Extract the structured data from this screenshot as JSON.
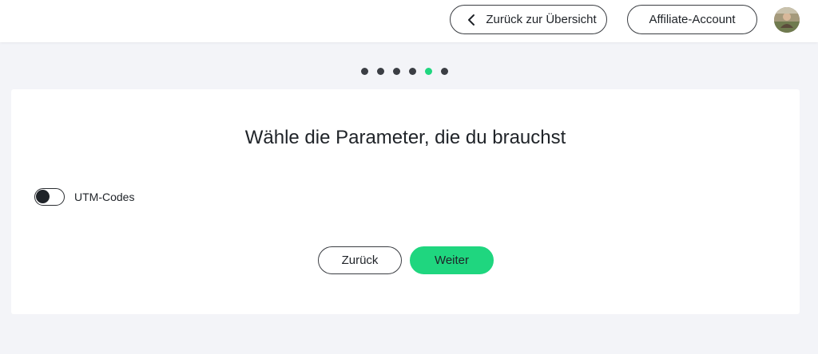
{
  "header": {
    "overview_button": "Zurück zur Übersicht",
    "affiliate_button": "Affiliate-Account"
  },
  "stepper": {
    "total_steps": 6,
    "current_step": 5
  },
  "card": {
    "title": "Wähle die Parameter, die du brauchst",
    "toggle": {
      "label": "UTM-Codes",
      "checked": false
    },
    "back_button": "Zurück",
    "next_button": "Weiter"
  },
  "colors": {
    "accent": "#1fd67f",
    "background": "#f3f4f8",
    "text": "#1f2328"
  },
  "icons": {
    "overview_button_icon": "chevron-left-icon",
    "avatar": "user-avatar"
  }
}
